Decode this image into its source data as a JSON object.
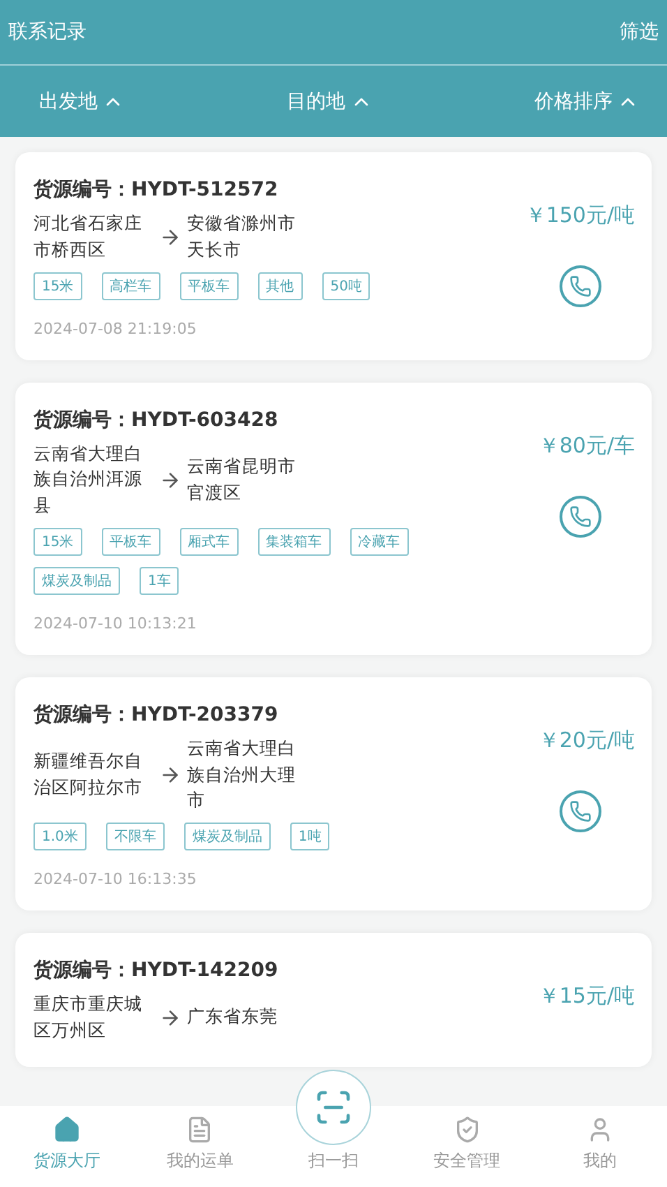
{
  "header": {
    "title": "联系记录",
    "action": "筛选"
  },
  "filters": [
    {
      "label": "出发地",
      "expanded": true
    },
    {
      "label": "目的地",
      "expanded": true
    },
    {
      "label": "价格排序",
      "expanded": true
    }
  ],
  "cards": [
    {
      "id_label": "货源编号：",
      "id": "HYDT-512572",
      "origin": "河北省石家庄市桥西区",
      "destination": "安徽省滁州市天长市",
      "price": "￥150元/吨",
      "tags": [
        "15米",
        "高栏车",
        "平板车",
        "其他",
        "50吨"
      ],
      "time": "2024-07-08 21:19:05"
    },
    {
      "id_label": "货源编号：",
      "id": "HYDT-603428",
      "origin": "云南省大理白族自治州洱源县",
      "destination": "云南省昆明市官渡区",
      "price": "￥80元/车",
      "tags": [
        "15米",
        "平板车",
        "厢式车",
        "集装箱车",
        "冷藏车",
        "煤炭及制品",
        "1车"
      ],
      "time": "2024-07-10 10:13:21"
    },
    {
      "id_label": "货源编号：",
      "id": "HYDT-203379",
      "origin": "新疆维吾尔自治区阿拉尔市",
      "destination": "云南省大理白族自治州大理市",
      "price": "￥20元/吨",
      "tags": [
        "1.0米",
        "不限车",
        "煤炭及制品",
        "1吨"
      ],
      "time": "2024-07-10 16:13:35"
    },
    {
      "id_label": "货源编号：",
      "id": "HYDT-142209",
      "origin": "重庆市重庆城区万州区",
      "destination": "广东省东莞",
      "price": "￥15元/吨"
    }
  ],
  "tabbar": [
    {
      "kind": "home",
      "label": "货源大厅",
      "selected": true
    },
    {
      "kind": "doc",
      "label": "我的运单",
      "selected": false
    },
    {
      "kind": "scan",
      "label": "扫一扫",
      "selected": false
    },
    {
      "kind": "shield",
      "label": "安全管理",
      "selected": false
    },
    {
      "kind": "user",
      "label": "我的",
      "selected": false
    }
  ]
}
